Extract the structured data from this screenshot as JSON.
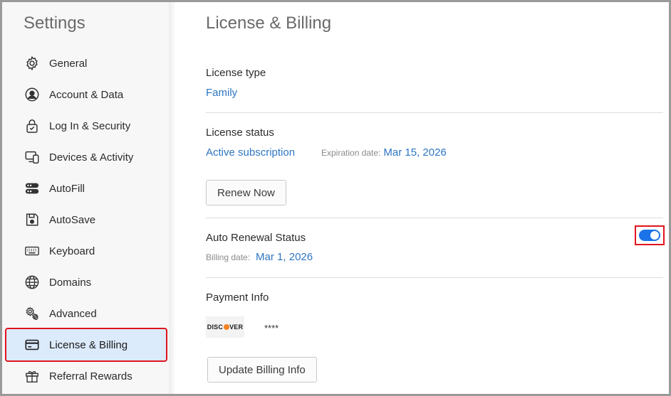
{
  "sidebar": {
    "title": "Settings",
    "items": [
      {
        "label": "General",
        "icon": "gear-icon"
      },
      {
        "label": "Account & Data",
        "icon": "person-circle-icon"
      },
      {
        "label": "Log In & Security",
        "icon": "lock-icon"
      },
      {
        "label": "Devices & Activity",
        "icon": "devices-icon"
      },
      {
        "label": "AutoFill",
        "icon": "autofill-icon"
      },
      {
        "label": "AutoSave",
        "icon": "save-icon"
      },
      {
        "label": "Keyboard",
        "icon": "keyboard-icon"
      },
      {
        "label": "Domains",
        "icon": "globe-icon"
      },
      {
        "label": "Advanced",
        "icon": "gears-icon"
      },
      {
        "label": "License & Billing",
        "icon": "credit-card-icon",
        "active": true
      },
      {
        "label": "Referral Rewards",
        "icon": "gift-icon"
      }
    ]
  },
  "main": {
    "title": "License & Billing",
    "license_type": {
      "label": "License type",
      "value": "Family"
    },
    "license_status": {
      "label": "License status",
      "value": "Active subscription",
      "expiration_label": "Expiration date:",
      "expiration_value": "Mar 15, 2026",
      "renew_button": "Renew Now"
    },
    "auto_renewal": {
      "label": "Auto Renewal Status",
      "enabled": true,
      "billing_label": "Billing date:",
      "billing_value": "Mar 1, 2026"
    },
    "payment": {
      "label": "Payment Info",
      "card_brand_left": "DISC",
      "card_brand_right": "VER",
      "card_masked": "****",
      "update_button": "Update Billing Info"
    }
  },
  "colors": {
    "accent": "#2e76c2",
    "toggle_on": "#1a73e8",
    "highlight": "#e0141e",
    "active_bg": "#dcebfc"
  }
}
